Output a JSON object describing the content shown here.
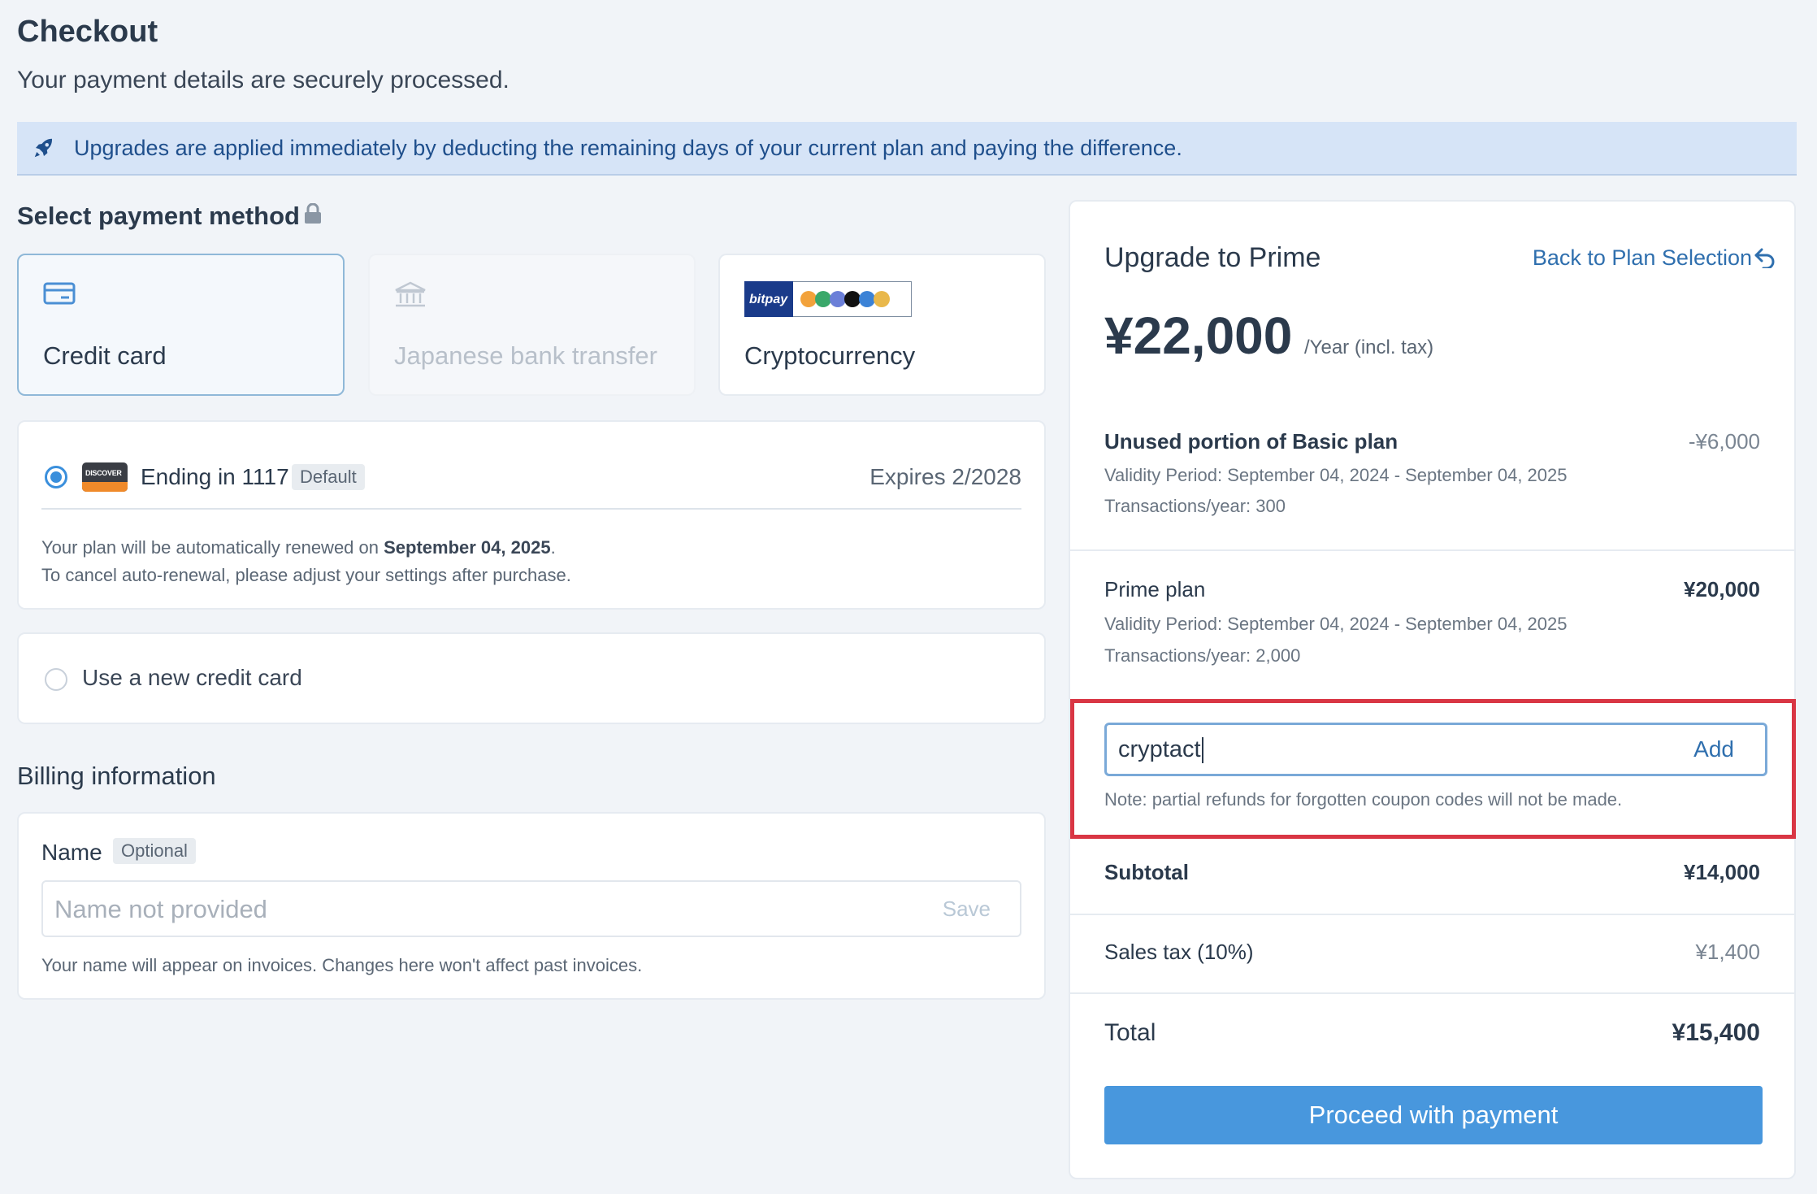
{
  "header": {
    "title": "Checkout",
    "subtitle": "Your payment details are securely processed."
  },
  "notice": {
    "icon": "rocket-icon",
    "text": "Upgrades are applied immediately by deducting the remaining days of your current plan and paying the difference."
  },
  "payment": {
    "section_title": "Select payment method",
    "lock_icon": "lock-icon",
    "methods": [
      {
        "label": "Credit card",
        "icon": "credit-card-icon",
        "state": "selected"
      },
      {
        "label": "Japanese bank transfer",
        "icon": "bank-icon",
        "state": "disabled"
      },
      {
        "label": "Cryptocurrency",
        "icon": "bitpay-logo",
        "logo_text": "bitpay",
        "state": "default"
      }
    ],
    "saved_card": {
      "brand_text": "DISCOVER",
      "ending": "Ending in 1117",
      "badge": "Default",
      "expires": "Expires 2/2028",
      "renew_prefix": "Your plan will be automatically renewed on ",
      "renew_date": "September 04, 2025",
      "renew_suffix": ".",
      "cancel_note": "To cancel auto-renewal, please adjust your settings after purchase."
    },
    "new_card_label": "Use a new credit card"
  },
  "billing": {
    "section_title": "Billing information",
    "name_label": "Name",
    "optional_badge": "Optional",
    "name_placeholder": "Name not provided",
    "save_label": "Save",
    "help": "Your name will appear on invoices. Changes here won't affect past invoices."
  },
  "summary": {
    "title": "Upgrade to Prime",
    "back_link": "Back to Plan Selection",
    "price": "¥22,000",
    "price_unit": "/Year (incl. tax)",
    "unused": {
      "title": "Unused portion of Basic plan",
      "amount": "-¥6,000",
      "validity": "Validity Period: September 04, 2024 - September 04, 2025",
      "transactions": "Transactions/year: 300"
    },
    "prime": {
      "title": "Prime plan",
      "amount": "¥20,000",
      "validity": "Validity Period: September 04, 2024 - September 04, 2025",
      "transactions": "Transactions/year: 2,000"
    },
    "coupon": {
      "value": "cryptact",
      "add_label": "Add",
      "note": "Note: partial refunds for forgotten coupon codes will not be made."
    },
    "subtotal": {
      "label": "Subtotal",
      "amount": "¥14,000"
    },
    "tax": {
      "label": "Sales tax (10%)",
      "amount": "¥1,400"
    },
    "total": {
      "label": "Total",
      "amount": "¥15,400"
    },
    "proceed_label": "Proceed with payment"
  },
  "colors": {
    "accent": "#4897dd",
    "link": "#2f6fae",
    "highlight_border": "#d93644",
    "notice_bg": "#d6e4f7"
  }
}
